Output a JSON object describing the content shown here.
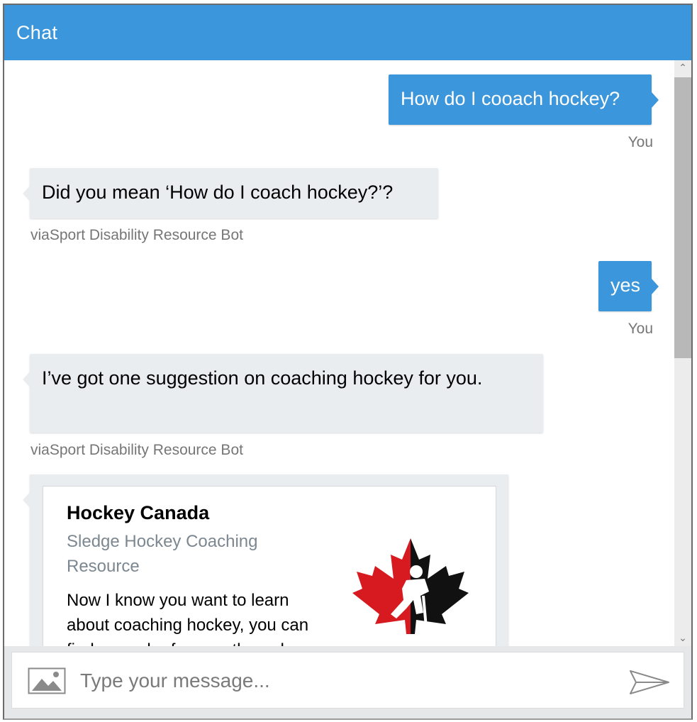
{
  "header": {
    "title": "Chat"
  },
  "messages": [
    {
      "from": "user",
      "text": "How do I cooach hockey?",
      "sender": "You"
    },
    {
      "from": "bot",
      "text": "Did you mean ‘How do I coach hockey?’?",
      "sender": "viaSport Disability Resource Bot"
    },
    {
      "from": "user",
      "text": "yes",
      "sender": "You"
    },
    {
      "from": "bot",
      "text": "I’ve got one suggestion on coaching hockey for you.",
      "sender": "viaSport Disability Resource Bot"
    }
  ],
  "card": {
    "title": "Hockey Canada",
    "subtitle": "Sledge Hockey Coaching Resource",
    "text": "Now I know you want to learn about coaching hockey, you can find a good reference through",
    "logo": "hockey-canada-maple-leaf-logo"
  },
  "composer": {
    "placeholder": "Type your message...",
    "upload_icon": "image-upload-icon",
    "send_icon": "send-arrow-icon"
  },
  "scrollbar": {
    "up": "⌃",
    "down": "⌄"
  },
  "colors": {
    "accent": "#3c96db",
    "bot_bubble": "#eaedf0",
    "logo_red": "#d71920"
  }
}
